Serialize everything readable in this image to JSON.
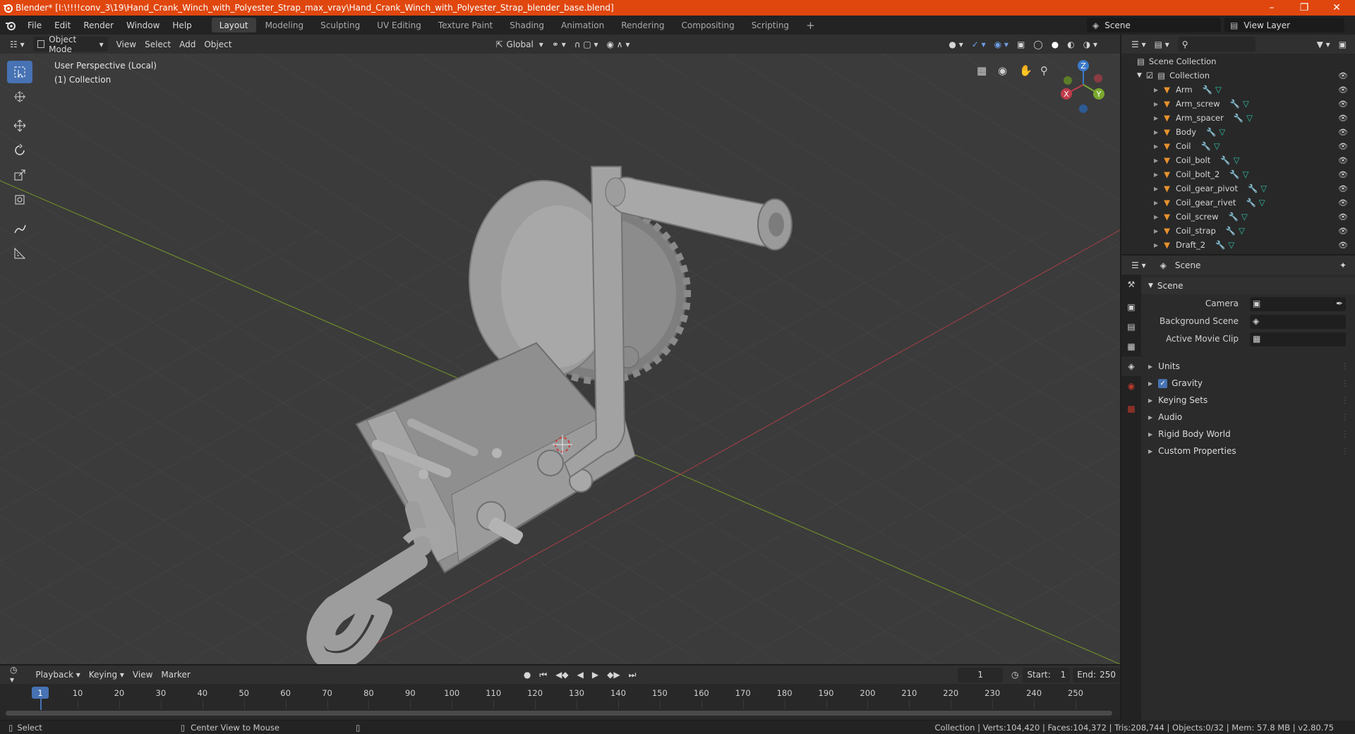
{
  "window": {
    "title": "Blender* [I:\\!!!!conv_3\\19\\Hand_Crank_Winch_with_Polyester_Strap_max_vray\\Hand_Crank_Winch_with_Polyester_Strap_blender_base.blend]",
    "controls": [
      "minimize-icon",
      "restore-icon",
      "close-icon"
    ]
  },
  "menu": {
    "items": [
      "File",
      "Edit",
      "Render",
      "Window",
      "Help"
    ]
  },
  "workspaces": {
    "tabs": [
      "Layout",
      "Modeling",
      "Sculpting",
      "UV Editing",
      "Texture Paint",
      "Shading",
      "Animation",
      "Rendering",
      "Compositing",
      "Scripting"
    ],
    "active": "Layout",
    "add_icon": "plus-icon"
  },
  "scene_selector": {
    "value": "Scene"
  },
  "view_layer_selector": {
    "value": "View Layer"
  },
  "viewport_header": {
    "mode": "Object Mode",
    "menus": [
      "View",
      "Select",
      "Add",
      "Object"
    ],
    "transform_orientation": "Global"
  },
  "viewport": {
    "perspective_label": "User Perspective (Local)",
    "collection_label": "(1) Collection",
    "gizmo_axes": {
      "x": "X",
      "y": "Y",
      "z": "Z"
    },
    "grid_color": "#454545",
    "x_axis_color": "#9a3d46",
    "y_axis_color": "#6c8a2a",
    "model_color": "#9a9a9a"
  },
  "tools": [
    "select-box-icon",
    "cursor-icon",
    "move-icon",
    "rotate-icon",
    "scale-icon",
    "transform-icon",
    "annotate-icon",
    "measure-icon"
  ],
  "outliner": {
    "root": "Scene Collection",
    "collection": "Collection",
    "objects": [
      "Arm",
      "Arm_screw",
      "Arm_spacer",
      "Body",
      "Coil",
      "Coil_bolt",
      "Coil_bolt_2",
      "Coil_gear_pivot",
      "Coil_gear_rivet",
      "Coil_screw",
      "Coil_strap",
      "Draft_2"
    ]
  },
  "properties": {
    "context": "Scene",
    "panel_scene": "Scene",
    "camera_label": "Camera",
    "background_scene_label": "Background Scene",
    "active_movie_clip_label": "Active Movie Clip",
    "subpanels": [
      "Units",
      "Gravity",
      "Keying Sets",
      "Audio",
      "Rigid Body World",
      "Custom Properties"
    ],
    "gravity_checked": true
  },
  "timeline": {
    "menus": [
      "Playback",
      "Keying",
      "View",
      "Marker"
    ],
    "current_frame": "1",
    "start_label": "Start:",
    "start": "1",
    "end_label": "End:",
    "end": "250",
    "ticks": [
      "1",
      "10",
      "20",
      "30",
      "40",
      "50",
      "60",
      "70",
      "80",
      "90",
      "100",
      "110",
      "120",
      "130",
      "140",
      "150",
      "160",
      "170",
      "180",
      "190",
      "200",
      "210",
      "220",
      "230",
      "240",
      "250"
    ]
  },
  "statusbar": {
    "left_action": "Select",
    "middle_action": "Center View to Mouse",
    "stats": "Collection | Verts:104,420 | Faces:104,372 | Tris:208,744 | Objects:0/32 | Mem: 57.8 MB | v2.80.75"
  }
}
